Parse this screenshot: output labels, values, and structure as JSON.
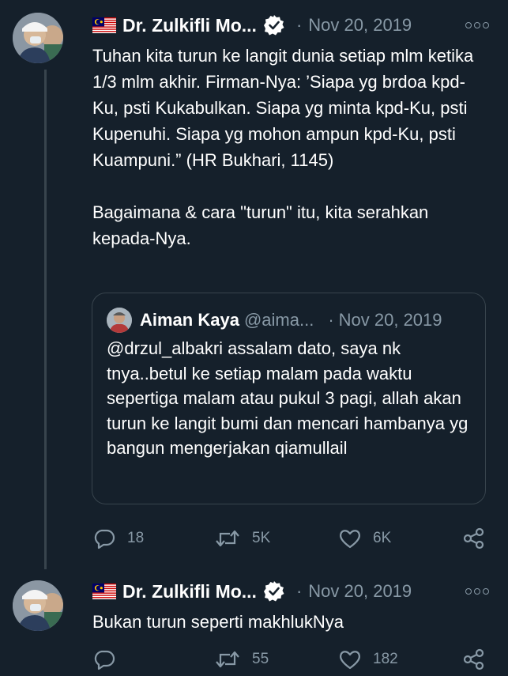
{
  "tweets": [
    {
      "author_name": "Dr. Zulkifli Mo...",
      "date": "Nov 20, 2019",
      "text": "Tuhan kita turun ke langit dunia setiap mlm ketika 1/3 mlm akhir. Firman-Nya: ’Siapa yg brdoa kpd-Ku, psti Kukabulkan. Siapa yg minta kpd-Ku, psti Kupenuhi. Siapa yg mohon ampun kpd-Ku, psti Kuampuni.” (HR Bukhari, 1145)\n\nBagaimana & cara \"turun\" itu, kita serahkan kepada-Nya.",
      "quote": {
        "author_name": "Aiman Kaya",
        "handle": "@aima...",
        "date": "Nov 20, 2019",
        "text": "@drzul_albakri assalam dato, saya nk tnya..betul ke setiap malam pada waktu sepertiga malam atau pukul 3 pagi, allah akan turun ke langit bumi dan mencari hambanya yg bangun mengerjakan qiamullail"
      },
      "replies": "18",
      "retweets": "5K",
      "likes": "6K"
    },
    {
      "author_name": "Dr. Zulkifli Mo...",
      "date": "Nov 20, 2019",
      "text": "Bukan turun seperti makhlukNya",
      "replies": "",
      "retweets": "55",
      "likes": "182"
    }
  ],
  "separator": "·",
  "colors": {
    "background": "#15202b",
    "text_primary": "#ffffff",
    "text_secondary": "#8899a6",
    "border": "#38444d"
  },
  "icons": [
    "malaysia-flag-icon",
    "verified-badge-icon",
    "more-options-icon",
    "reply-icon",
    "retweet-icon",
    "like-icon",
    "share-icon"
  ]
}
